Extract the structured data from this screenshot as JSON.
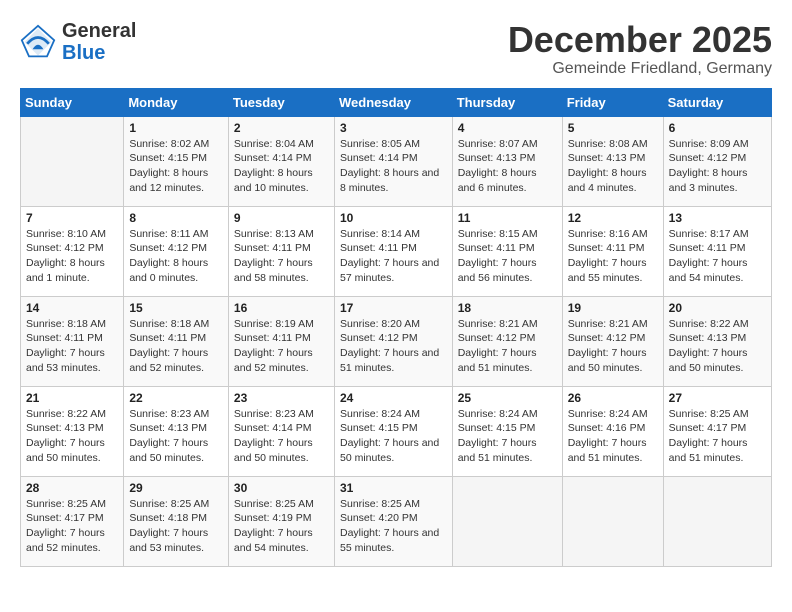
{
  "header": {
    "logo_general": "General",
    "logo_blue": "Blue",
    "month_title": "December 2025",
    "subtitle": "Gemeinde Friedland, Germany"
  },
  "days_of_week": [
    "Sunday",
    "Monday",
    "Tuesday",
    "Wednesday",
    "Thursday",
    "Friday",
    "Saturday"
  ],
  "weeks": [
    [
      {
        "day": "",
        "sunrise": "",
        "sunset": "",
        "daylight": ""
      },
      {
        "day": "1",
        "sunrise": "Sunrise: 8:02 AM",
        "sunset": "Sunset: 4:15 PM",
        "daylight": "Daylight: 8 hours and 12 minutes."
      },
      {
        "day": "2",
        "sunrise": "Sunrise: 8:04 AM",
        "sunset": "Sunset: 4:14 PM",
        "daylight": "Daylight: 8 hours and 10 minutes."
      },
      {
        "day": "3",
        "sunrise": "Sunrise: 8:05 AM",
        "sunset": "Sunset: 4:14 PM",
        "daylight": "Daylight: 8 hours and 8 minutes."
      },
      {
        "day": "4",
        "sunrise": "Sunrise: 8:07 AM",
        "sunset": "Sunset: 4:13 PM",
        "daylight": "Daylight: 8 hours and 6 minutes."
      },
      {
        "day": "5",
        "sunrise": "Sunrise: 8:08 AM",
        "sunset": "Sunset: 4:13 PM",
        "daylight": "Daylight: 8 hours and 4 minutes."
      },
      {
        "day": "6",
        "sunrise": "Sunrise: 8:09 AM",
        "sunset": "Sunset: 4:12 PM",
        "daylight": "Daylight: 8 hours and 3 minutes."
      }
    ],
    [
      {
        "day": "7",
        "sunrise": "Sunrise: 8:10 AM",
        "sunset": "Sunset: 4:12 PM",
        "daylight": "Daylight: 8 hours and 1 minute."
      },
      {
        "day": "8",
        "sunrise": "Sunrise: 8:11 AM",
        "sunset": "Sunset: 4:12 PM",
        "daylight": "Daylight: 8 hours and 0 minutes."
      },
      {
        "day": "9",
        "sunrise": "Sunrise: 8:13 AM",
        "sunset": "Sunset: 4:11 PM",
        "daylight": "Daylight: 7 hours and 58 minutes."
      },
      {
        "day": "10",
        "sunrise": "Sunrise: 8:14 AM",
        "sunset": "Sunset: 4:11 PM",
        "daylight": "Daylight: 7 hours and 57 minutes."
      },
      {
        "day": "11",
        "sunrise": "Sunrise: 8:15 AM",
        "sunset": "Sunset: 4:11 PM",
        "daylight": "Daylight: 7 hours and 56 minutes."
      },
      {
        "day": "12",
        "sunrise": "Sunrise: 8:16 AM",
        "sunset": "Sunset: 4:11 PM",
        "daylight": "Daylight: 7 hours and 55 minutes."
      },
      {
        "day": "13",
        "sunrise": "Sunrise: 8:17 AM",
        "sunset": "Sunset: 4:11 PM",
        "daylight": "Daylight: 7 hours and 54 minutes."
      }
    ],
    [
      {
        "day": "14",
        "sunrise": "Sunrise: 8:18 AM",
        "sunset": "Sunset: 4:11 PM",
        "daylight": "Daylight: 7 hours and 53 minutes."
      },
      {
        "day": "15",
        "sunrise": "Sunrise: 8:18 AM",
        "sunset": "Sunset: 4:11 PM",
        "daylight": "Daylight: 7 hours and 52 minutes."
      },
      {
        "day": "16",
        "sunrise": "Sunrise: 8:19 AM",
        "sunset": "Sunset: 4:11 PM",
        "daylight": "Daylight: 7 hours and 52 minutes."
      },
      {
        "day": "17",
        "sunrise": "Sunrise: 8:20 AM",
        "sunset": "Sunset: 4:12 PM",
        "daylight": "Daylight: 7 hours and 51 minutes."
      },
      {
        "day": "18",
        "sunrise": "Sunrise: 8:21 AM",
        "sunset": "Sunset: 4:12 PM",
        "daylight": "Daylight: 7 hours and 51 minutes."
      },
      {
        "day": "19",
        "sunrise": "Sunrise: 8:21 AM",
        "sunset": "Sunset: 4:12 PM",
        "daylight": "Daylight: 7 hours and 50 minutes."
      },
      {
        "day": "20",
        "sunrise": "Sunrise: 8:22 AM",
        "sunset": "Sunset: 4:13 PM",
        "daylight": "Daylight: 7 hours and 50 minutes."
      }
    ],
    [
      {
        "day": "21",
        "sunrise": "Sunrise: 8:22 AM",
        "sunset": "Sunset: 4:13 PM",
        "daylight": "Daylight: 7 hours and 50 minutes."
      },
      {
        "day": "22",
        "sunrise": "Sunrise: 8:23 AM",
        "sunset": "Sunset: 4:13 PM",
        "daylight": "Daylight: 7 hours and 50 minutes."
      },
      {
        "day": "23",
        "sunrise": "Sunrise: 8:23 AM",
        "sunset": "Sunset: 4:14 PM",
        "daylight": "Daylight: 7 hours and 50 minutes."
      },
      {
        "day": "24",
        "sunrise": "Sunrise: 8:24 AM",
        "sunset": "Sunset: 4:15 PM",
        "daylight": "Daylight: 7 hours and 50 minutes."
      },
      {
        "day": "25",
        "sunrise": "Sunrise: 8:24 AM",
        "sunset": "Sunset: 4:15 PM",
        "daylight": "Daylight: 7 hours and 51 minutes."
      },
      {
        "day": "26",
        "sunrise": "Sunrise: 8:24 AM",
        "sunset": "Sunset: 4:16 PM",
        "daylight": "Daylight: 7 hours and 51 minutes."
      },
      {
        "day": "27",
        "sunrise": "Sunrise: 8:25 AM",
        "sunset": "Sunset: 4:17 PM",
        "daylight": "Daylight: 7 hours and 51 minutes."
      }
    ],
    [
      {
        "day": "28",
        "sunrise": "Sunrise: 8:25 AM",
        "sunset": "Sunset: 4:17 PM",
        "daylight": "Daylight: 7 hours and 52 minutes."
      },
      {
        "day": "29",
        "sunrise": "Sunrise: 8:25 AM",
        "sunset": "Sunset: 4:18 PM",
        "daylight": "Daylight: 7 hours and 53 minutes."
      },
      {
        "day": "30",
        "sunrise": "Sunrise: 8:25 AM",
        "sunset": "Sunset: 4:19 PM",
        "daylight": "Daylight: 7 hours and 54 minutes."
      },
      {
        "day": "31",
        "sunrise": "Sunrise: 8:25 AM",
        "sunset": "Sunset: 4:20 PM",
        "daylight": "Daylight: 7 hours and 55 minutes."
      },
      {
        "day": "",
        "sunrise": "",
        "sunset": "",
        "daylight": ""
      },
      {
        "day": "",
        "sunrise": "",
        "sunset": "",
        "daylight": ""
      },
      {
        "day": "",
        "sunrise": "",
        "sunset": "",
        "daylight": ""
      }
    ]
  ]
}
